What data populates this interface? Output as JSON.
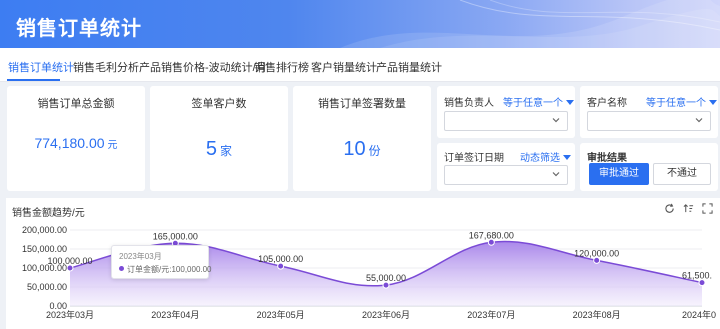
{
  "header": {
    "title": "销售订单统计"
  },
  "tabs": [
    {
      "label": "销售订单统计"
    },
    {
      "label": "销售毛利分析"
    },
    {
      "label": "产品销售价格-波动统计/月"
    },
    {
      "label": "销售排行榜"
    },
    {
      "label": "客户销量统计"
    },
    {
      "label": "产品销量统计"
    }
  ],
  "kpis": {
    "total_amount": {
      "title": "销售订单总金额",
      "value": "774,180.00",
      "unit": "元"
    },
    "customers": {
      "title": "签单客户数",
      "value": "5",
      "unit": "家"
    },
    "orders": {
      "title": "销售订单签署数量",
      "value": "10",
      "unit": "份"
    }
  },
  "filters": {
    "sales_owner": {
      "label": "销售负责人",
      "mode": "等于任意一个"
    },
    "customer_name": {
      "label": "客户名称",
      "mode": "等于任意一个"
    },
    "sign_date": {
      "label": "订单签订日期",
      "mode": "动态筛选"
    },
    "approval": {
      "label": "审批结果",
      "approved": "审批通过",
      "rejected": "不通过"
    }
  },
  "chart": {
    "title": "销售金额趋势/元",
    "tooltip": {
      "title": "2023年03月",
      "series_label": "订单金额/元",
      "value": "100,000.00"
    },
    "colors": {
      "line": "#7b4bd6",
      "area_top": "#a07ae8",
      "area_bottom": "#f1ebfc"
    }
  },
  "chart_data": {
    "type": "area",
    "x": [
      "2023年03月",
      "2023年04月",
      "2023年05月",
      "2023年06月",
      "2023年07月",
      "2023年08月",
      "2024年0"
    ],
    "series": [
      {
        "name": "订单金额/元",
        "values": [
          100000,
          165000,
          105000,
          55000,
          167680,
          120000,
          61500
        ]
      }
    ],
    "data_labels": [
      "100,000.00",
      "165,000.00",
      "105,000.00",
      "55,000.00",
      "167,680.00",
      "120,000.00",
      "61,500."
    ],
    "y_ticks": [
      "0.00",
      "50,000.00",
      "100,000.00",
      "150,000.00",
      "200,000.00"
    ],
    "ylim": [
      0,
      200000
    ],
    "grid": "horizontal"
  }
}
